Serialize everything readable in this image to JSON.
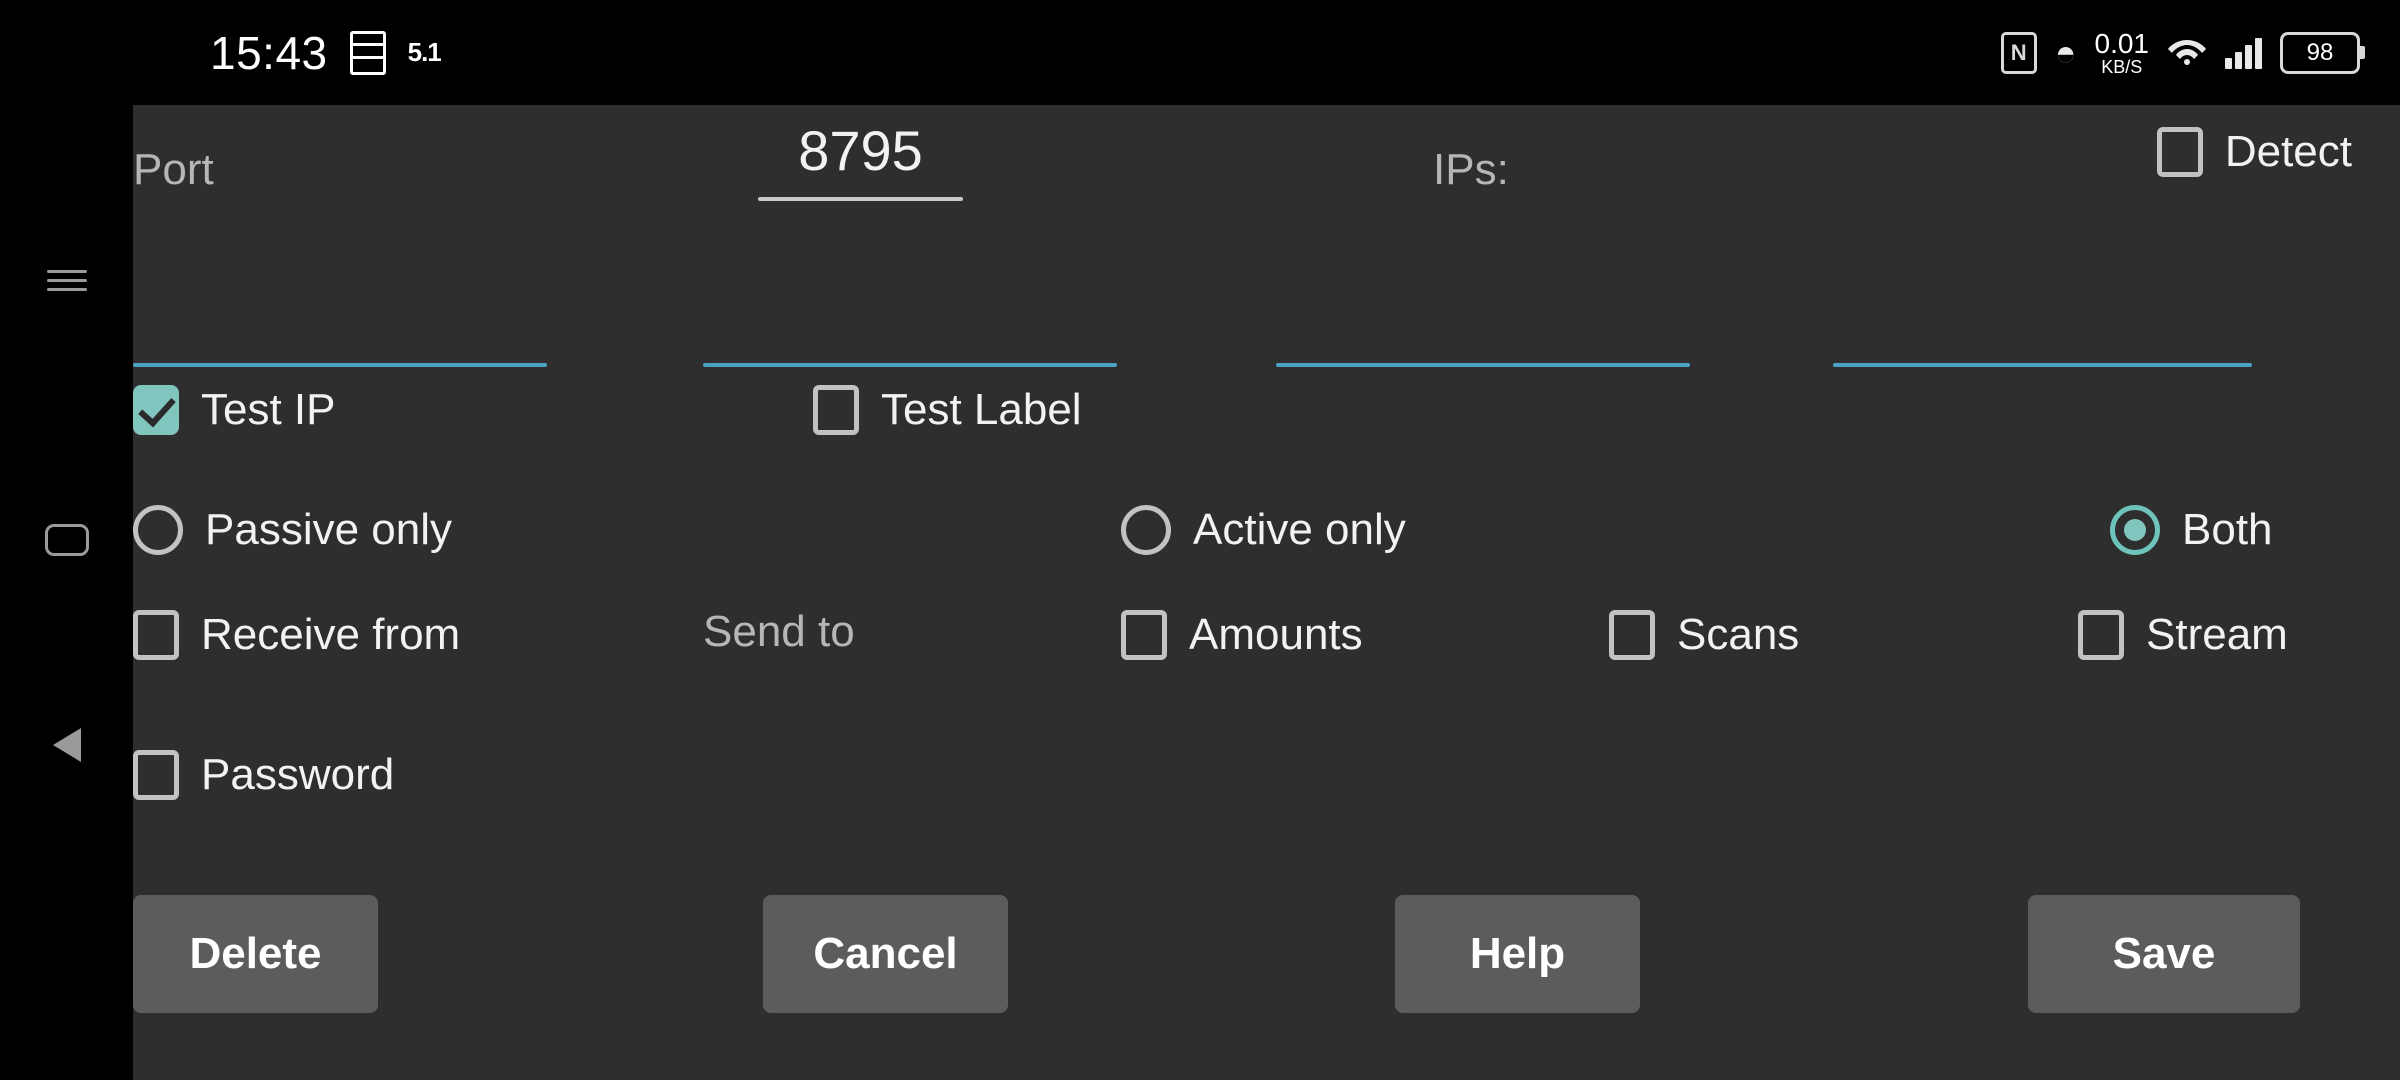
{
  "status_bar": {
    "time": "15:43",
    "doc_icon": "document-icon",
    "version": "5.1",
    "nfc_glyph": "N",
    "bluetooth_glyph": "ᛦ",
    "net_speed_value": "0.01",
    "net_speed_unit": "KB/S",
    "wifi_glyph": "὏6",
    "battery_level": "98"
  },
  "navbar": {
    "recents": "recents-icon",
    "home": "home-icon",
    "back": "back-icon"
  },
  "form": {
    "port_label": "Port",
    "port_value": "8795",
    "ips_label": "IPs:",
    "detect_label": "Detect",
    "detect_checked": false,
    "test_ip_label": "Test IP",
    "test_ip_checked": true,
    "test_label_label": "Test Label",
    "test_label_checked": false,
    "mode_options": [
      {
        "label": "Passive only",
        "selected": false
      },
      {
        "label": "Active only",
        "selected": false
      },
      {
        "label": "Both",
        "selected": true
      }
    ],
    "flags": [
      {
        "label": "Receive from",
        "checked": false,
        "has_box": true
      },
      {
        "label": "Send to",
        "checked": false,
        "has_box": false
      },
      {
        "label": "Amounts",
        "checked": false,
        "has_box": true
      },
      {
        "label": "Scans",
        "checked": false,
        "has_box": true
      },
      {
        "label": "Stream",
        "checked": false,
        "has_box": true
      }
    ],
    "password_label": "Password",
    "password_checked": false
  },
  "buttons": {
    "delete": "Delete",
    "cancel": "Cancel",
    "help": "Help",
    "save": "Save"
  },
  "colors": {
    "accent_teal": "#80c6be",
    "underline_blue": "#4aa3c7",
    "panel_bg": "#2e2e2e",
    "button_bg": "#5c5c5c"
  }
}
